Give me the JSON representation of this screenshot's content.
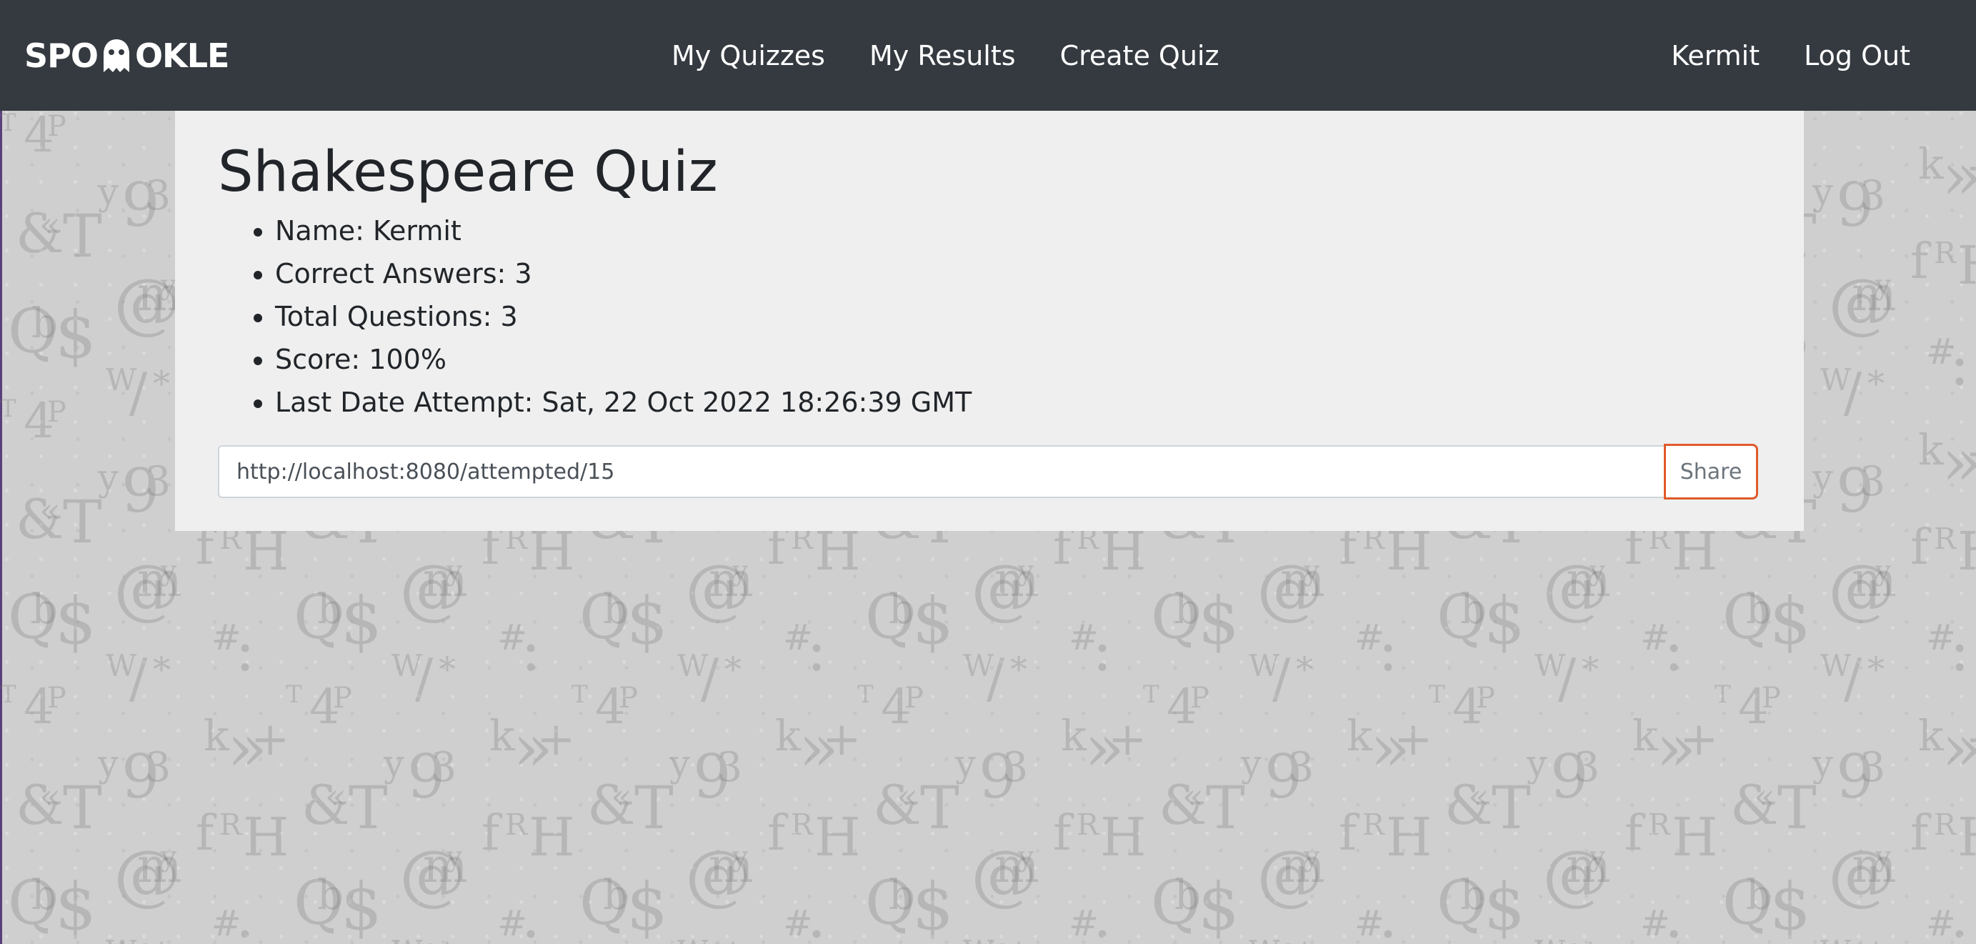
{
  "brand": {
    "logo_left": "SPO",
    "logo_right": "OKLE"
  },
  "nav": {
    "center": [
      {
        "label": "My Quizzes"
      },
      {
        "label": "My Results"
      },
      {
        "label": "Create Quiz"
      }
    ],
    "right": [
      {
        "label": "Kermit"
      },
      {
        "label": "Log Out"
      }
    ]
  },
  "result": {
    "title": "Shakespeare Quiz",
    "details": [
      "Name: Kermit",
      "Correct Answers: 3",
      "Total Questions: 3",
      "Score: 100%",
      "Last Date Attempt: Sat, 22 Oct 2022 18:26:39 GMT"
    ],
    "share_url": "http://localhost:8080/attempted/15",
    "share_label": "Share"
  },
  "colors": {
    "navbar": "#343a40",
    "card": "#efefef",
    "share_border": "#e05a2b"
  }
}
